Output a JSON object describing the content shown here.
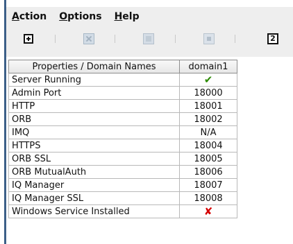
{
  "menubar": {
    "items": [
      {
        "mnemonic": "A",
        "rest": "ction"
      },
      {
        "mnemonic": "O",
        "rest": "ptions"
      },
      {
        "mnemonic": "H",
        "rest": "elp"
      }
    ]
  },
  "toolbar": {
    "refresh_glyph": "2"
  },
  "table": {
    "headers": [
      "Properties / Domain Names",
      "domain1"
    ],
    "rows": [
      {
        "name": "Server Running",
        "value": "✔"
      },
      {
        "name": "Admin Port",
        "value": "18000"
      },
      {
        "name": "HTTP",
        "value": "18001"
      },
      {
        "name": "ORB",
        "value": "18002"
      },
      {
        "name": "IMQ",
        "value": "N/A"
      },
      {
        "name": "HTTPS",
        "value": "18004"
      },
      {
        "name": "ORB SSL",
        "value": "18005"
      },
      {
        "name": "ORB MutualAuth",
        "value": "18006"
      },
      {
        "name": "IQ Manager",
        "value": "18007"
      },
      {
        "name": "IQ Manager SSL",
        "value": "18008"
      },
      {
        "name": "Windows Service Installed",
        "value": "✘"
      }
    ]
  }
}
